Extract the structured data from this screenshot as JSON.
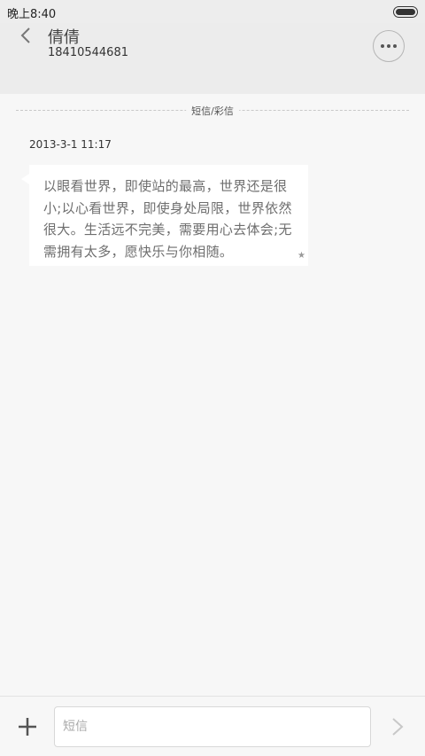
{
  "status_bar": {
    "time": "晚上8:40",
    "battery_level": 1.0
  },
  "header": {
    "contact_name": "倩倩",
    "contact_number": "18410544681",
    "more_icon": "more-options-icon",
    "back_icon": "back-arrow-icon"
  },
  "conversation": {
    "divider_label": "短信/彩信",
    "messages": [
      {
        "timestamp": "2013-3-1 11:17",
        "text": "以眼看世界，即使站的最高，世界还是很小;以心看世界，即使身处局限，世界依然很大。生活远不完美，需要用心去体会;无需拥有太多，愿快乐与你相随。",
        "starred": true
      }
    ]
  },
  "composer": {
    "placeholder": "短信",
    "value": "",
    "add_icon": "plus-icon",
    "send_icon": "chevron-right-icon"
  }
}
